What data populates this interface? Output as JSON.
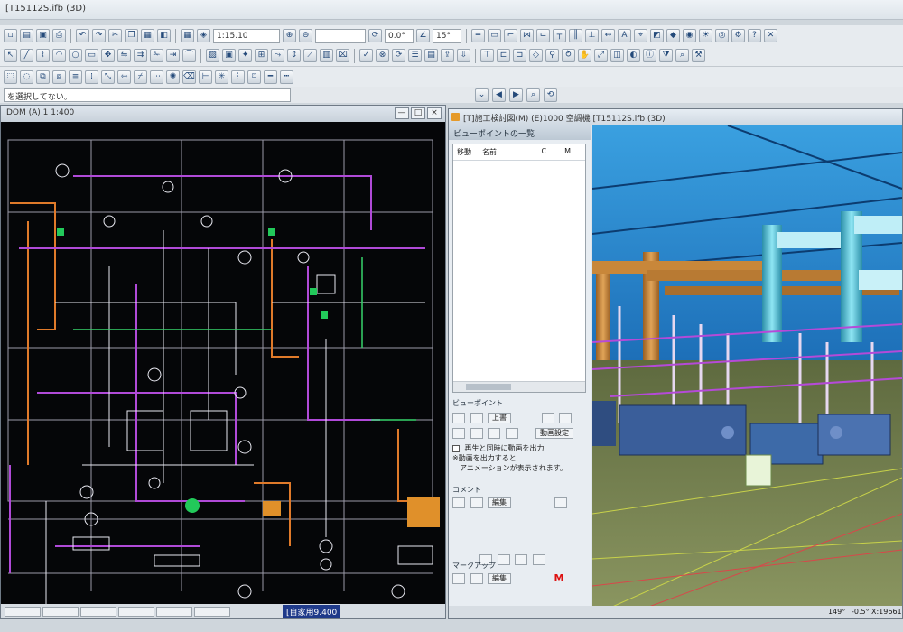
{
  "titlebar": {
    "text": "[T15112S.ifb (3D)"
  },
  "toolbar1": {
    "scale_value": "1:15.10",
    "angle_value": "0.0°",
    "angle2_value": "15°"
  },
  "message_bar": {
    "text": "を選択してない。"
  },
  "cad_window": {
    "title": "DOM (A) 1 1:400",
    "status_label": "[自家用9.400",
    "window_buttons": [
      "—",
      "□",
      "×"
    ]
  },
  "viewpoint_window": {
    "title": "[T]施工検討図(M) (E)1000 空調機 [T15112S.ifb (3D)",
    "panel_title": "ビューポイントの一覧",
    "list_columns": {
      "move": "移動",
      "name": "名前",
      "c": "C",
      "m": "M"
    },
    "viewpoint_section": "ビューポイント",
    "overwrite_button": "上書",
    "video_settings_button": "動画設定",
    "checkbox_label": "再生と同時に動画を出力",
    "note_line1": "※動画を出力すると",
    "note_line2": "アニメーションが表示されます。",
    "comment_section": "コメント",
    "comment_edit_button": "編集",
    "markup_section": "マークアップ",
    "markup_edit_button": "編集",
    "markup_icon": "M",
    "status_angle1": "149°",
    "status_angle2": "-0.5°",
    "status_coord": "X:19661"
  },
  "icons": [
    "pointer-icon",
    "zoom-icon",
    "layer-icon",
    "pipe-icon",
    "duct-icon",
    "save-icon"
  ],
  "colors": {
    "cad_bg": "#050608",
    "pipe_orange": "#c8873a",
    "pipe_cyan": "#4fc3d9",
    "equipment_blue": "#3a5e9a"
  }
}
